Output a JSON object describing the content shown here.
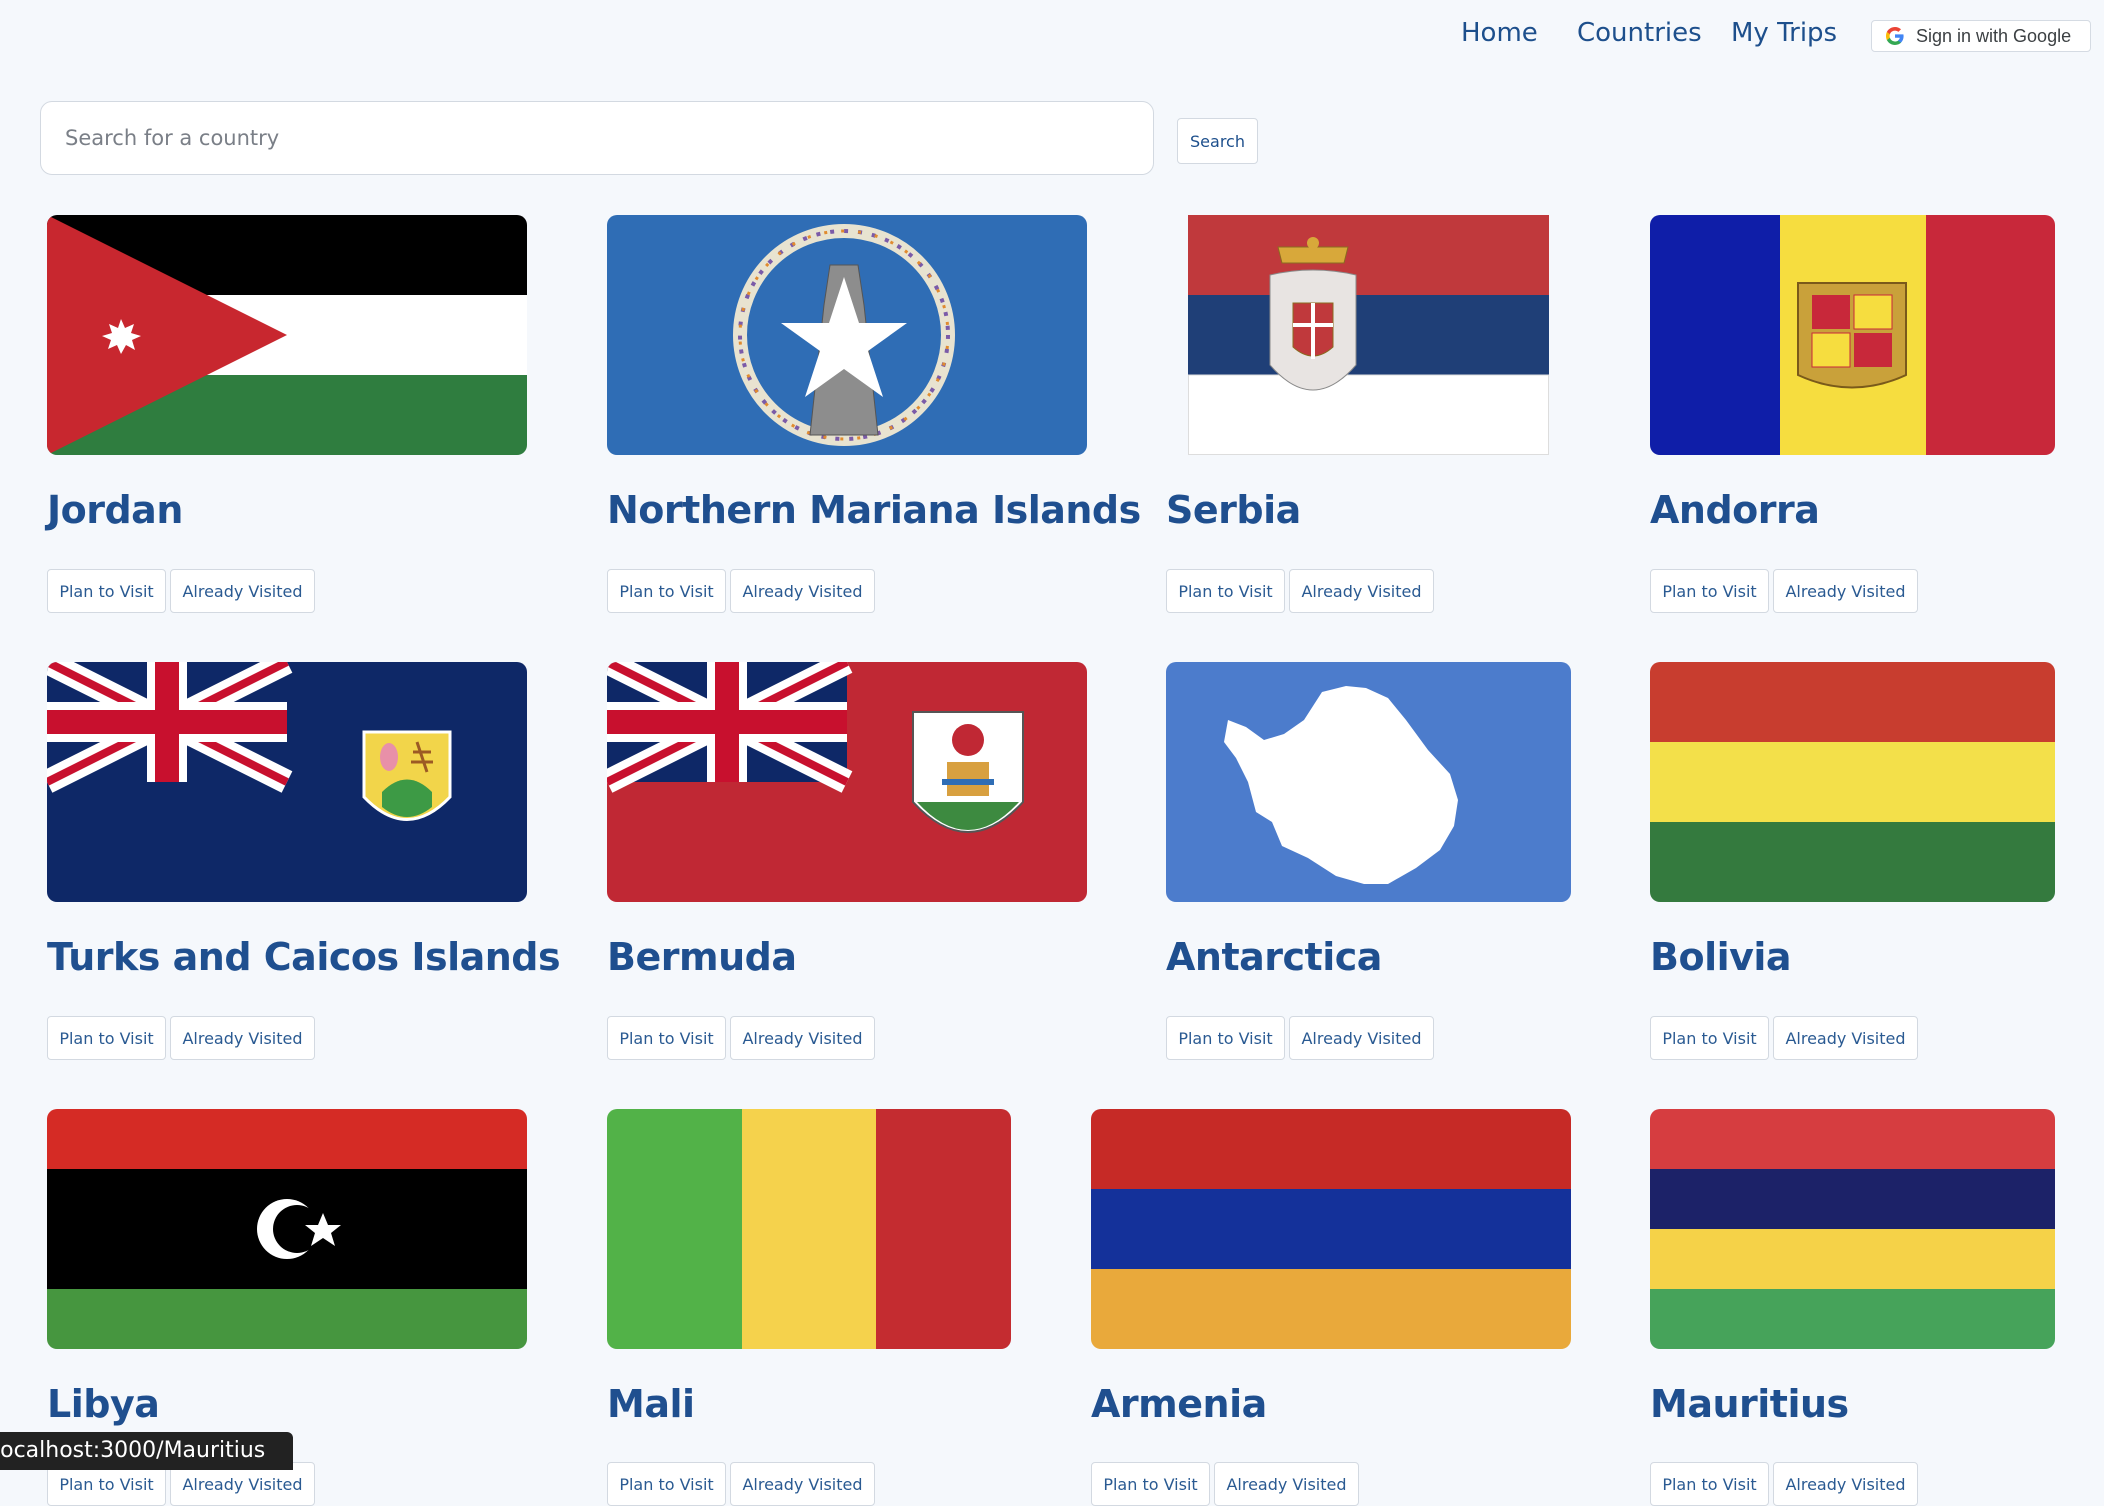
{
  "nav": {
    "home": "Home",
    "countries": "Countries",
    "my_trips": "My Trips",
    "google_signin": "Sign in with Google"
  },
  "search": {
    "placeholder": "Search for a country",
    "button": "Search"
  },
  "buttons": {
    "plan": "Plan to Visit",
    "visited": "Already Visited"
  },
  "countries": [
    {
      "name": "Jordan",
      "flag": "jordan-flag"
    },
    {
      "name": "Northern Mariana Islands",
      "flag": "northern-mariana-islands-flag"
    },
    {
      "name": "Serbia",
      "flag": "serbia-flag"
    },
    {
      "name": "Andorra",
      "flag": "andorra-flag"
    },
    {
      "name": "Turks and Caicos Islands",
      "flag": "turks-and-caicos-flag"
    },
    {
      "name": "Bermuda",
      "flag": "bermuda-flag"
    },
    {
      "name": "Antarctica",
      "flag": "antarctica-flag"
    },
    {
      "name": "Bolivia",
      "flag": "bolivia-flag"
    },
    {
      "name": "Libya",
      "flag": "libya-flag"
    },
    {
      "name": "Mali",
      "flag": "mali-flag"
    },
    {
      "name": "Armenia",
      "flag": "armenia-flag"
    },
    {
      "name": "Mauritius",
      "flag": "mauritius-flag"
    }
  ],
  "status_bar": "localhost:3000/Mauritius",
  "colors": {
    "accent": "#1f4f8f",
    "background": "#f5f8fc"
  }
}
